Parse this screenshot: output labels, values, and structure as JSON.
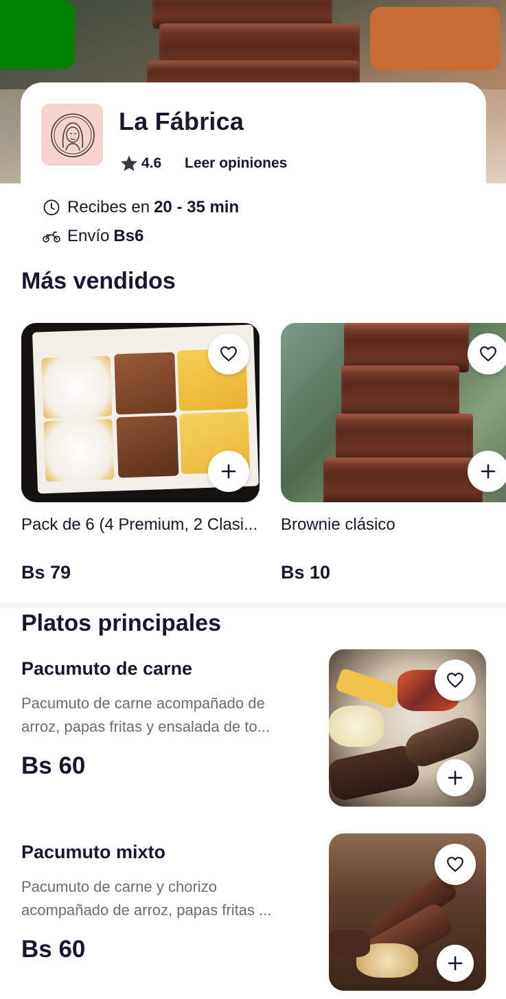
{
  "store": {
    "name": "La Fábrica",
    "rating": "4.6",
    "reviews_link": "Leer opiniones"
  },
  "delivery": {
    "time_prefix": "Recibes en",
    "time_value": "20 - 35 min",
    "fee_prefix": "Envío",
    "fee_value": "Bs6"
  },
  "best_sellers": {
    "title": "Más vendidos",
    "items": [
      {
        "name": "Pack de 6 (4 Premium, 2 Clasi...",
        "price": "Bs 79"
      },
      {
        "name": "Brownie clásico",
        "price": "Bs 10"
      }
    ]
  },
  "main_dishes": {
    "title": "Platos principales",
    "items": [
      {
        "name": "Pacumuto de carne",
        "description": "Pacumuto de carne acompañado de arroz, papas fritas y ensalada de to...",
        "price": "Bs 60"
      },
      {
        "name": "Pacumuto mixto",
        "description": "Pacumuto de carne y chorizo acompañado de arroz, papas fritas ...",
        "price": "Bs 60"
      }
    ]
  },
  "colors": {
    "back_button": "#008000",
    "share_button": "#c86b34",
    "text_primary": "#1b1530",
    "text_secondary": "#6e6a78"
  },
  "icons": {
    "rating": "star-icon",
    "time": "clock-icon",
    "delivery": "motorbike-icon",
    "favorite": "heart-icon",
    "add": "plus-icon"
  }
}
